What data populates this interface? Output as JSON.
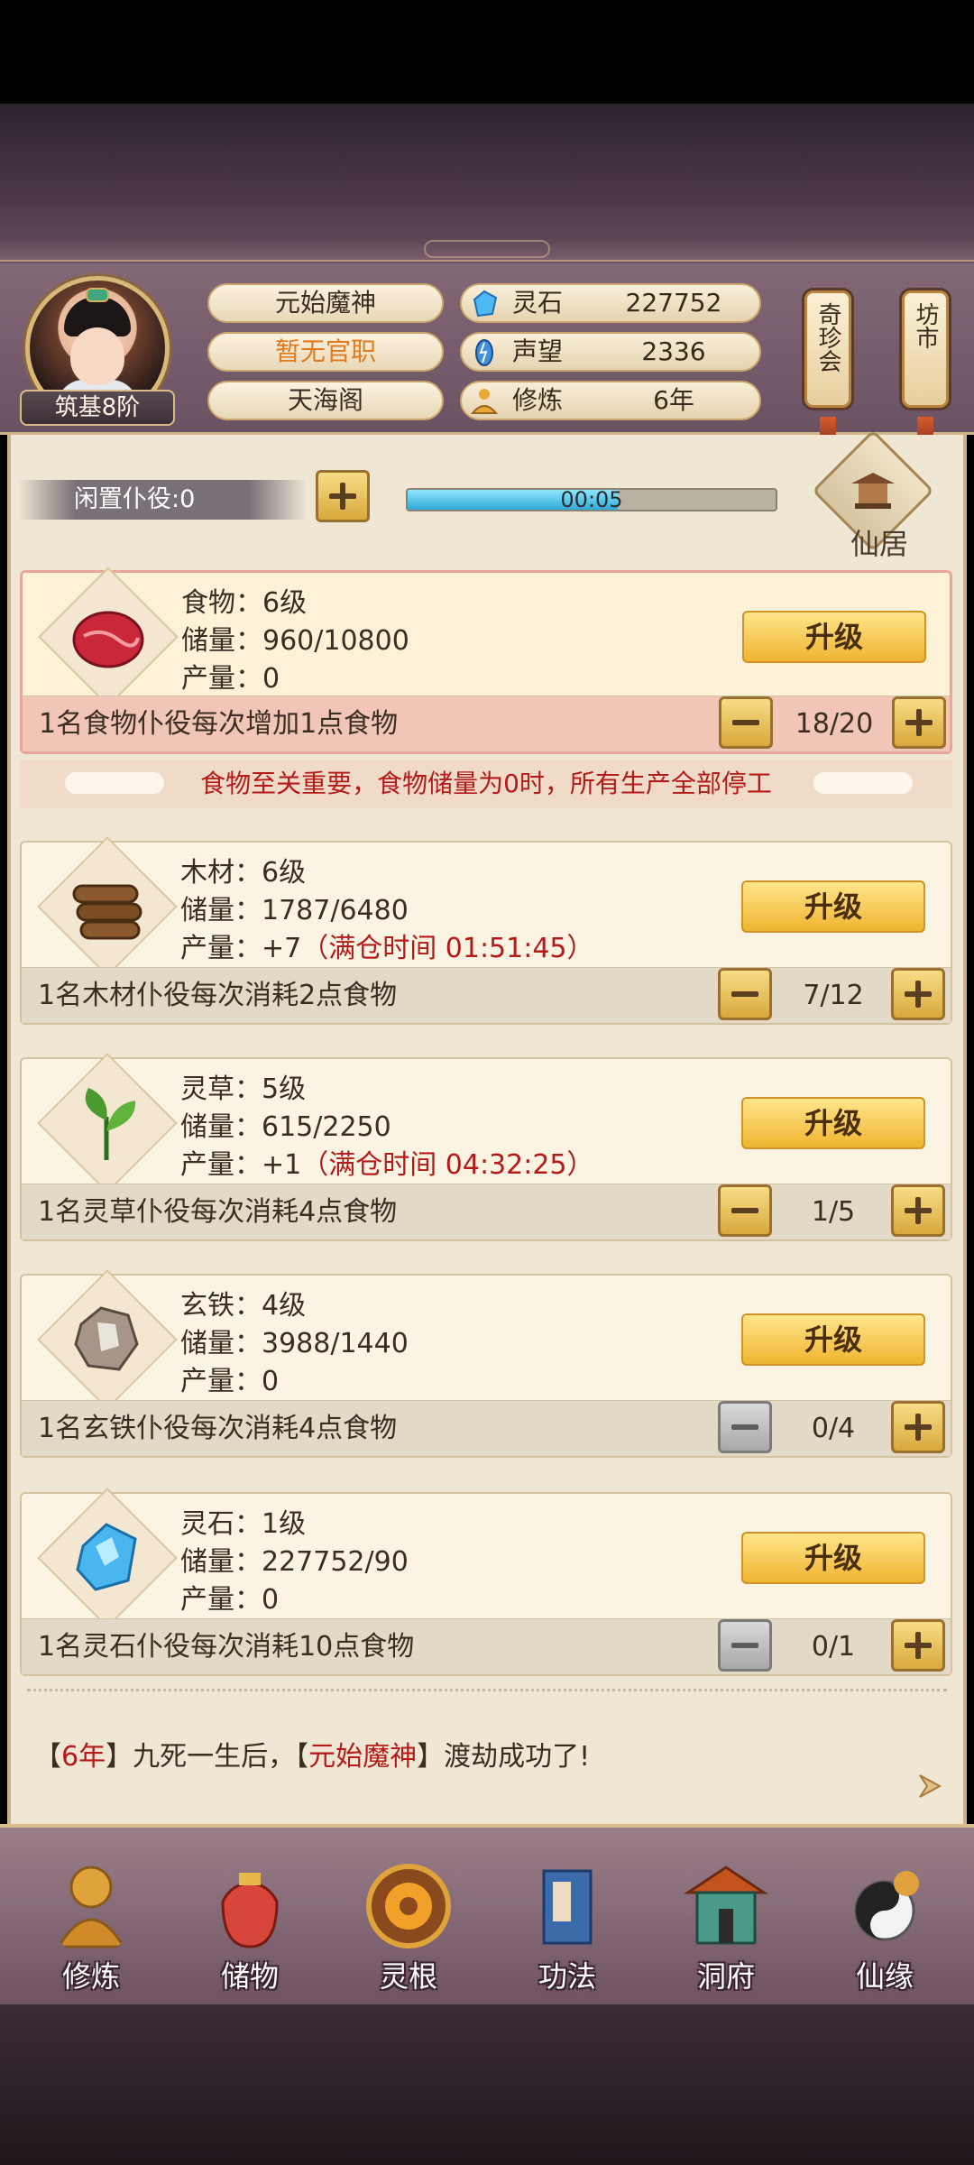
{
  "header": {
    "rank_badge": "筑基8阶",
    "name": "元始魔神",
    "official_post": "暂无官职",
    "sect": "天海阁",
    "resources": [
      {
        "icon": "spirit-stone-icon",
        "label": "灵石",
        "value": "227752"
      },
      {
        "icon": "prestige-icon",
        "label": "声望",
        "value": "2336"
      },
      {
        "icon": "cultivation-icon",
        "label": "修炼",
        "value": "6年"
      }
    ],
    "tags": [
      {
        "label": "奇珍会"
      },
      {
        "label": "坊市"
      }
    ]
  },
  "idle": {
    "label": "闲置仆役:0",
    "timer": "00:05",
    "timer_progress": 0.57
  },
  "xianju": {
    "label": "仙居"
  },
  "cards": [
    {
      "name": "食物：6级",
      "storage": "储量：960/10800",
      "output": "产量：0",
      "output_note": "",
      "upgrade": "升级",
      "worker_desc": "1名食物仆役每次增加1点食物",
      "count": "18/20"
    },
    {
      "name": "木材：6级",
      "storage": "储量：1787/6480",
      "output": "产量：+7",
      "output_note": "（满仓时间 01:51:45）",
      "upgrade": "升级",
      "worker_desc": "1名木材仆役每次消耗2点食物",
      "count": "7/12"
    },
    {
      "name": "灵草：5级",
      "storage": "储量：615/2250",
      "output": "产量：+1",
      "output_note": "（满仓时间 04:32:25）",
      "upgrade": "升级",
      "worker_desc": "1名灵草仆役每次消耗4点食物",
      "count": "1/5"
    },
    {
      "name": "玄铁：4级",
      "storage": "储量：3988/1440",
      "output": "产量：0",
      "output_note": "",
      "upgrade": "升级",
      "worker_desc": "1名玄铁仆役每次消耗4点食物",
      "count": "0/4"
    },
    {
      "name": "灵石：1级",
      "storage": "储量：227752/90",
      "output": "产量：0",
      "output_note": "",
      "upgrade": "升级",
      "worker_desc": "1名灵石仆役每次消耗10点食物",
      "count": "0/1"
    }
  ],
  "food_warning": "食物至关重要，食物储量为0时，所有生产全部停工",
  "log": {
    "p1": "【",
    "year": "6年",
    "p2": "】九死一生后，【",
    "name": "元始魔神",
    "p3": "】渡劫成功了!"
  },
  "nav": [
    {
      "label": "修炼",
      "icon": "cultivate-icon"
    },
    {
      "label": "储物",
      "icon": "storage-bag-icon"
    },
    {
      "label": "灵根",
      "icon": "spirit-root-icon"
    },
    {
      "label": "功法",
      "icon": "skill-book-icon"
    },
    {
      "label": "洞府",
      "icon": "cave-mansion-icon"
    },
    {
      "label": "仙缘",
      "icon": "fate-icon"
    }
  ],
  "colors": {
    "accent_red": "#b51a1a",
    "gold_button": "#f0b431",
    "progress": "#30a9d8"
  }
}
